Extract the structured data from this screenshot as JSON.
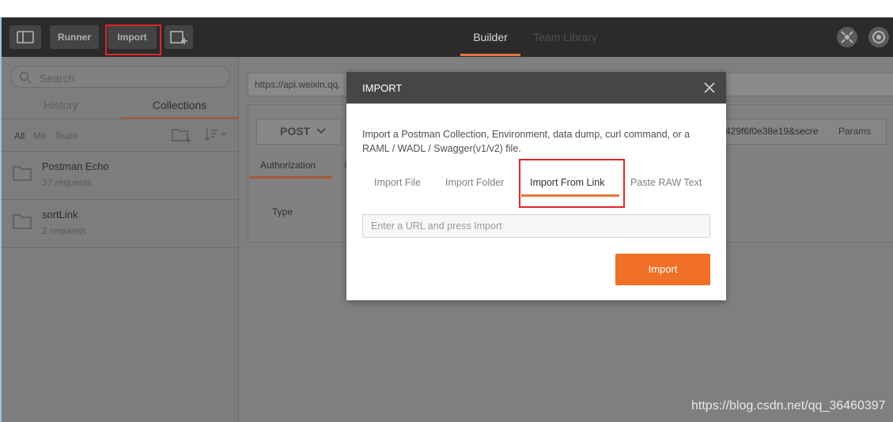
{
  "header": {
    "runner_label": "Runner",
    "import_label": "Import",
    "tabs": [
      "Builder",
      "Team Library"
    ],
    "icons": [
      "sidebar-toggle-icon",
      "new-tab-icon",
      "satellite-icon",
      "sync-icon"
    ]
  },
  "sidebar": {
    "search_placeholder": "Search",
    "tabs": [
      "History",
      "Collections"
    ],
    "filters": [
      "All",
      "Me",
      "Team"
    ],
    "collections": [
      {
        "name": "Postman Echo",
        "count": "37 requests"
      },
      {
        "name": "sortLink",
        "count": "2 requests"
      }
    ]
  },
  "request": {
    "url_fragment": "https://api.weixin.qq.",
    "method": "POST",
    "url_right": "429f6f0e38e19&secre",
    "params_label": "Params",
    "auth_tab": "Authorization",
    "auth_next_fragment": "I",
    "type_label": "Type"
  },
  "modal": {
    "title": "IMPORT",
    "description": "Import a Postman Collection, Environment, data dump, curl command, or a RAML / WADL / Swagger(v1/v2) file.",
    "tabs": [
      "Import File",
      "Import Folder",
      "Import From Link",
      "Paste RAW Text"
    ],
    "active_tab": "Import From Link",
    "url_placeholder": "Enter a URL and press Import",
    "url_value": "",
    "import_button": "Import"
  },
  "colors": {
    "accent": "#f07027",
    "highlight_box": "#e0262b",
    "header_bg": "#2b2b2b"
  },
  "watermark": "https://blog.csdn.net/qq_36460397"
}
